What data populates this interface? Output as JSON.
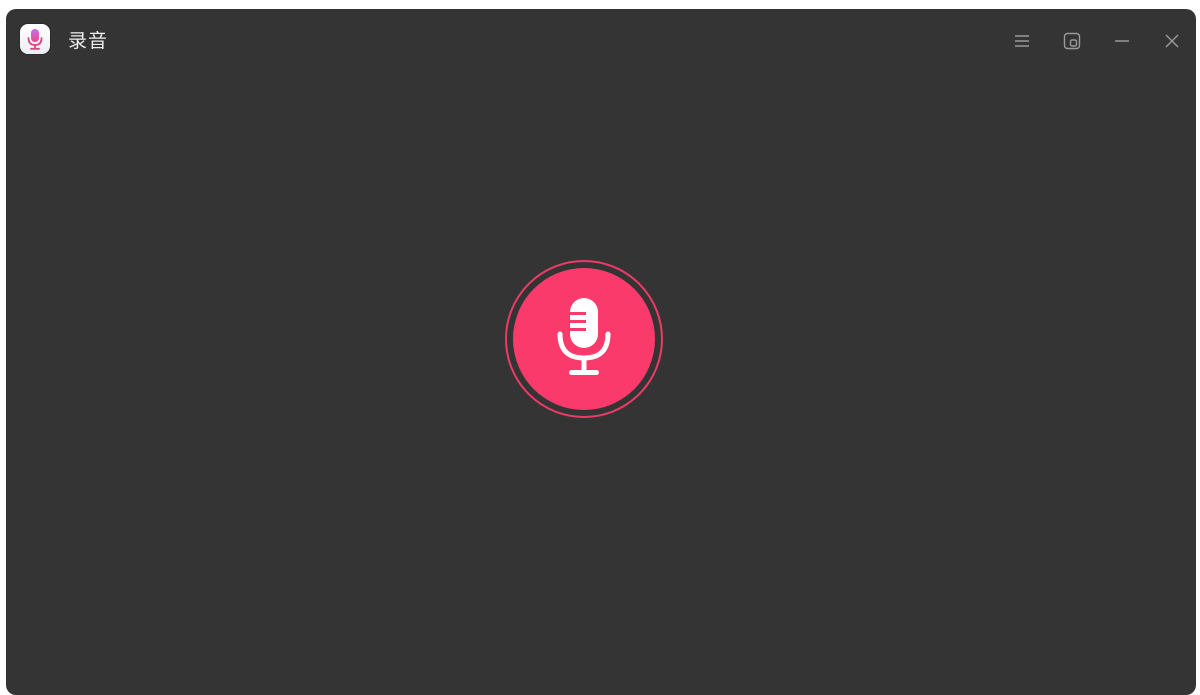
{
  "window": {
    "title": "录音"
  },
  "titlebar": {
    "icons": {
      "app": "microphone-app-icon",
      "menu": "menu-icon",
      "float": "floating-window-icon",
      "minimize": "minimize-icon",
      "close": "close-icon"
    }
  },
  "main": {
    "record_button_icon": "microphone-icon"
  },
  "colors": {
    "background": "#343434",
    "record_button": "#fb3a6c",
    "record_ring": "#ee3a66",
    "title_text": "#f0f0f0",
    "control_icon": "#9a9a9a"
  }
}
